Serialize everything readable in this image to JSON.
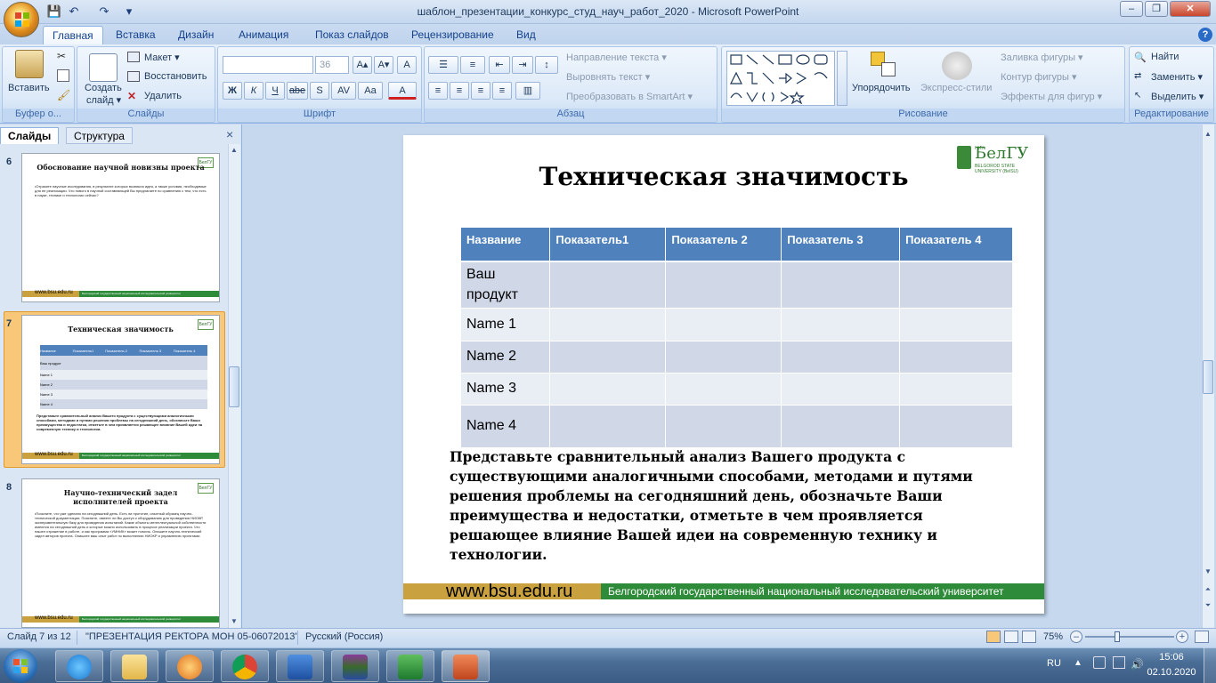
{
  "window": {
    "title": "шаблон_презентации_конкурс_студ_науч_работ_2020 - Microsoft PowerPoint",
    "controls": {
      "minimize": "–",
      "maximize": "❐",
      "close": "✕"
    }
  },
  "quick_access": {
    "save": "💾",
    "undo": "↶",
    "redo": "↷",
    "customize": "▾"
  },
  "tabs": [
    "Главная",
    "Вставка",
    "Дизайн",
    "Анимация",
    "Показ слайдов",
    "Рецензирование",
    "Вид"
  ],
  "help": "?",
  "ribbon": {
    "clipboard": {
      "paste": "Вставить",
      "label": "Буфер о..."
    },
    "slides": {
      "create": "Создать",
      "create2": "слайд ▾",
      "layout": "Макет ▾",
      "reset": "Восстановить",
      "delete": "Удалить",
      "label": "Слайды"
    },
    "font": {
      "size": "36",
      "bold": "Ж",
      "italic": "К",
      "underline": "Ч",
      "strike": "abe",
      "shadow": "S",
      "spacing": "AV",
      "case": "Aa",
      "color": "A",
      "grow": "A▴",
      "shrink": "A▾",
      "clear": "A",
      "label": "Шрифт"
    },
    "paragraph": {
      "text_direction": "Направление текста ▾",
      "align_text": "Выровнять текст ▾",
      "smartart": "Преобразовать в SmartArt ▾",
      "label": "Абзац"
    },
    "drawing": {
      "arrange": "Упорядочить",
      "quick_styles": "Экспресс-стили",
      "fill": "Заливка фигуры ▾",
      "outline": "Контур фигуры ▾",
      "effects": "Эффекты для фигур ▾",
      "label": "Рисование"
    },
    "editing": {
      "find": "Найти",
      "replace": "Заменить ▾",
      "select": "Выделить ▾",
      "label": "Редактирование"
    }
  },
  "panel": {
    "tab_slides": "Слайды",
    "tab_outline": "Структура",
    "close": "×",
    "thumbs": [
      {
        "num": "6",
        "title": "Обоснование научной новизны проекта",
        "text": "•Отразите научные исследования, в результате которых возникла идея, а также условия, необходимые для ее реализации. Что нового в научной составляющей Вы предлагаете по сравнению с тем, что есть в науке, технике и технологии сейчас?",
        "footer": "www.bsu.edu.ru",
        "footer_bar": "Белгородский государственный национальный исследовательский университет",
        "logo": "БелГУ"
      },
      {
        "num": "7",
        "title": "Техническая значимость",
        "text": "Представьте сравнительный анализ Вашего продукта с существующими аналогичными способами, методами и путями решения проблемы на сегодняшний день, обозначьте Ваши преимущества и недостатки, отметьте в чем проявляется решающее влияние Вашей идеи на современную технику и технологии.",
        "footer": "www.bsu.edu.ru",
        "footer_bar": "Белгородский государственный национальный исследовательский университет",
        "logo": "БелГУ",
        "mini_table_header": [
          "Название",
          "Показатель1",
          "Показатель 2",
          "Показатель 3",
          "Показатель 4"
        ],
        "mini_table_rows": [
          "Ваш продукт",
          "Name 1",
          "Name 2",
          "Name 3",
          "Name 4"
        ]
      },
      {
        "num": "8",
        "title": "Научно-технический задел исполнителей проекта",
        "text": "•Поясните, что уже сделано на сегодняшний день. Есть ли прототип, опытный образец научно-технической документации. Поясните, имеете ли Вы доступ к оборудованию для проведения НИОКР, экспериментальную базу для проведения испытаний. Какие объекты интеллектуальной собственности имеются на сегодняшний день и которые можно использовать в процессе реализации проекта. Что нашел отражение в работе, и как программа «УМНИК» может помочь. Опишите научно-технический задел авторов проекта. Опишите ваш опыт работ по выполнению НИОКР и управлению проектами.",
        "footer": "www.bsu.edu.ru",
        "footer_bar": "Белгородский государственный национальный исследовательский университет",
        "logo": "БелГУ"
      }
    ]
  },
  "slide": {
    "title": "Техническая значимость",
    "logo_text": "БелГУ",
    "logo_sub": "НИУ",
    "logo_en": "BELGOROD STATE UNIVERSITY (BelSU)",
    "table": {
      "header": [
        "Название",
        "Показатель1",
        "Показатель 2",
        "Показатель 3",
        "Показатель 4"
      ],
      "rows": [
        [
          "Ваш продукт",
          "",
          "",
          "",
          ""
        ],
        [
          "Name 1",
          "",
          "",
          "",
          ""
        ],
        [
          "Name 2",
          "",
          "",
          "",
          ""
        ],
        [
          "Name 3",
          "",
          "",
          "",
          ""
        ],
        [
          "Name 4",
          "",
          "",
          "",
          ""
        ]
      ]
    },
    "body": "Представьте сравнительный анализ Вашего продукта с существующими аналогичными способами, методами и путями решения проблемы на сегодняшний день, обозначьте Ваши преимущества и недостатки, отметьте  в чем проявляется решающее влияние Вашей идеи на современную технику и технологии.",
    "footer_site": "www.bsu.edu.ru",
    "footer_bar": "Белгородский государственный национальный исследовательский университет"
  },
  "status": {
    "slide": "Слайд 7 из 12",
    "theme": "\"ПРЕЗЕНТАЦИЯ РЕКТОРА МОН 05-06072013\"",
    "language": "Русский (Россия)",
    "zoom": "75%",
    "zoom_level": 0.75
  },
  "taskbar": {
    "lang": "RU",
    "time": "15:06",
    "date": "02.10.2020"
  },
  "colors": {
    "table_header": "#4f81bd",
    "row_odd": "#d0d8e8",
    "row_even": "#e9edf4",
    "footer_gold": "#c9a23f",
    "footer_green": "#2e8b3a"
  }
}
